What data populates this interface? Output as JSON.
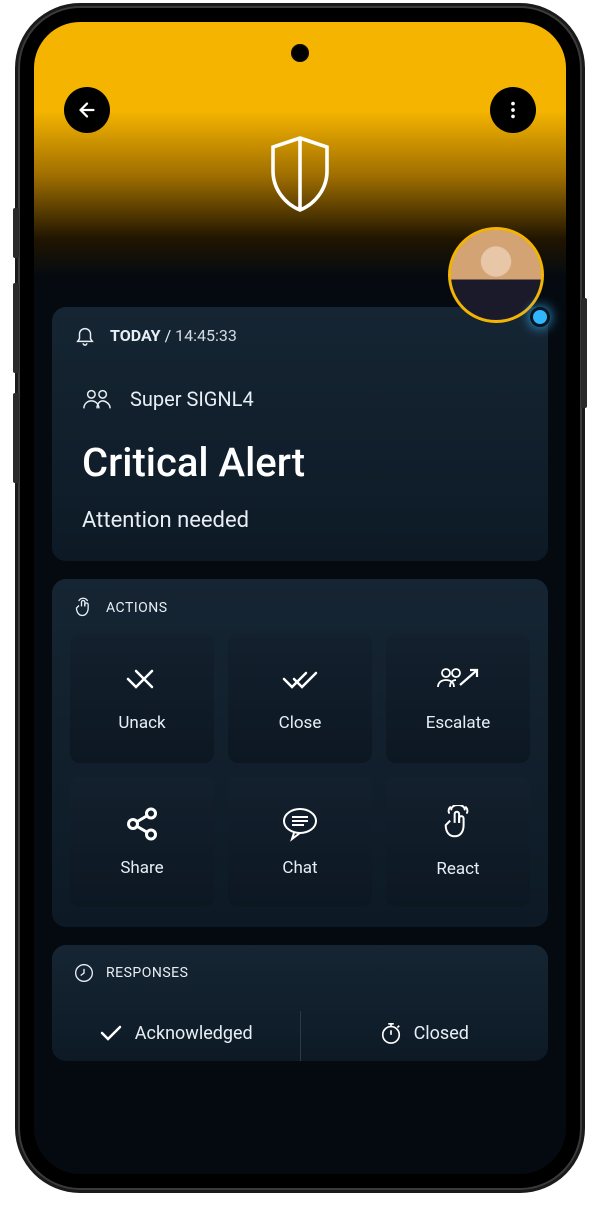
{
  "timestamp": {
    "day": "TODAY",
    "time": "14:45:33"
  },
  "alert": {
    "group": "Super SIGNL4",
    "title": "Critical Alert",
    "message": "Attention needed"
  },
  "sections": {
    "actions_label": "ACTIONS",
    "responses_label": "RESPONSES"
  },
  "actions": {
    "unack": "Unack",
    "close": "Close",
    "escalate": "Escalate",
    "share": "Share",
    "chat": "Chat",
    "react": "React"
  },
  "responses": {
    "acknowledged": "Acknowledged",
    "closed": "Closed"
  }
}
